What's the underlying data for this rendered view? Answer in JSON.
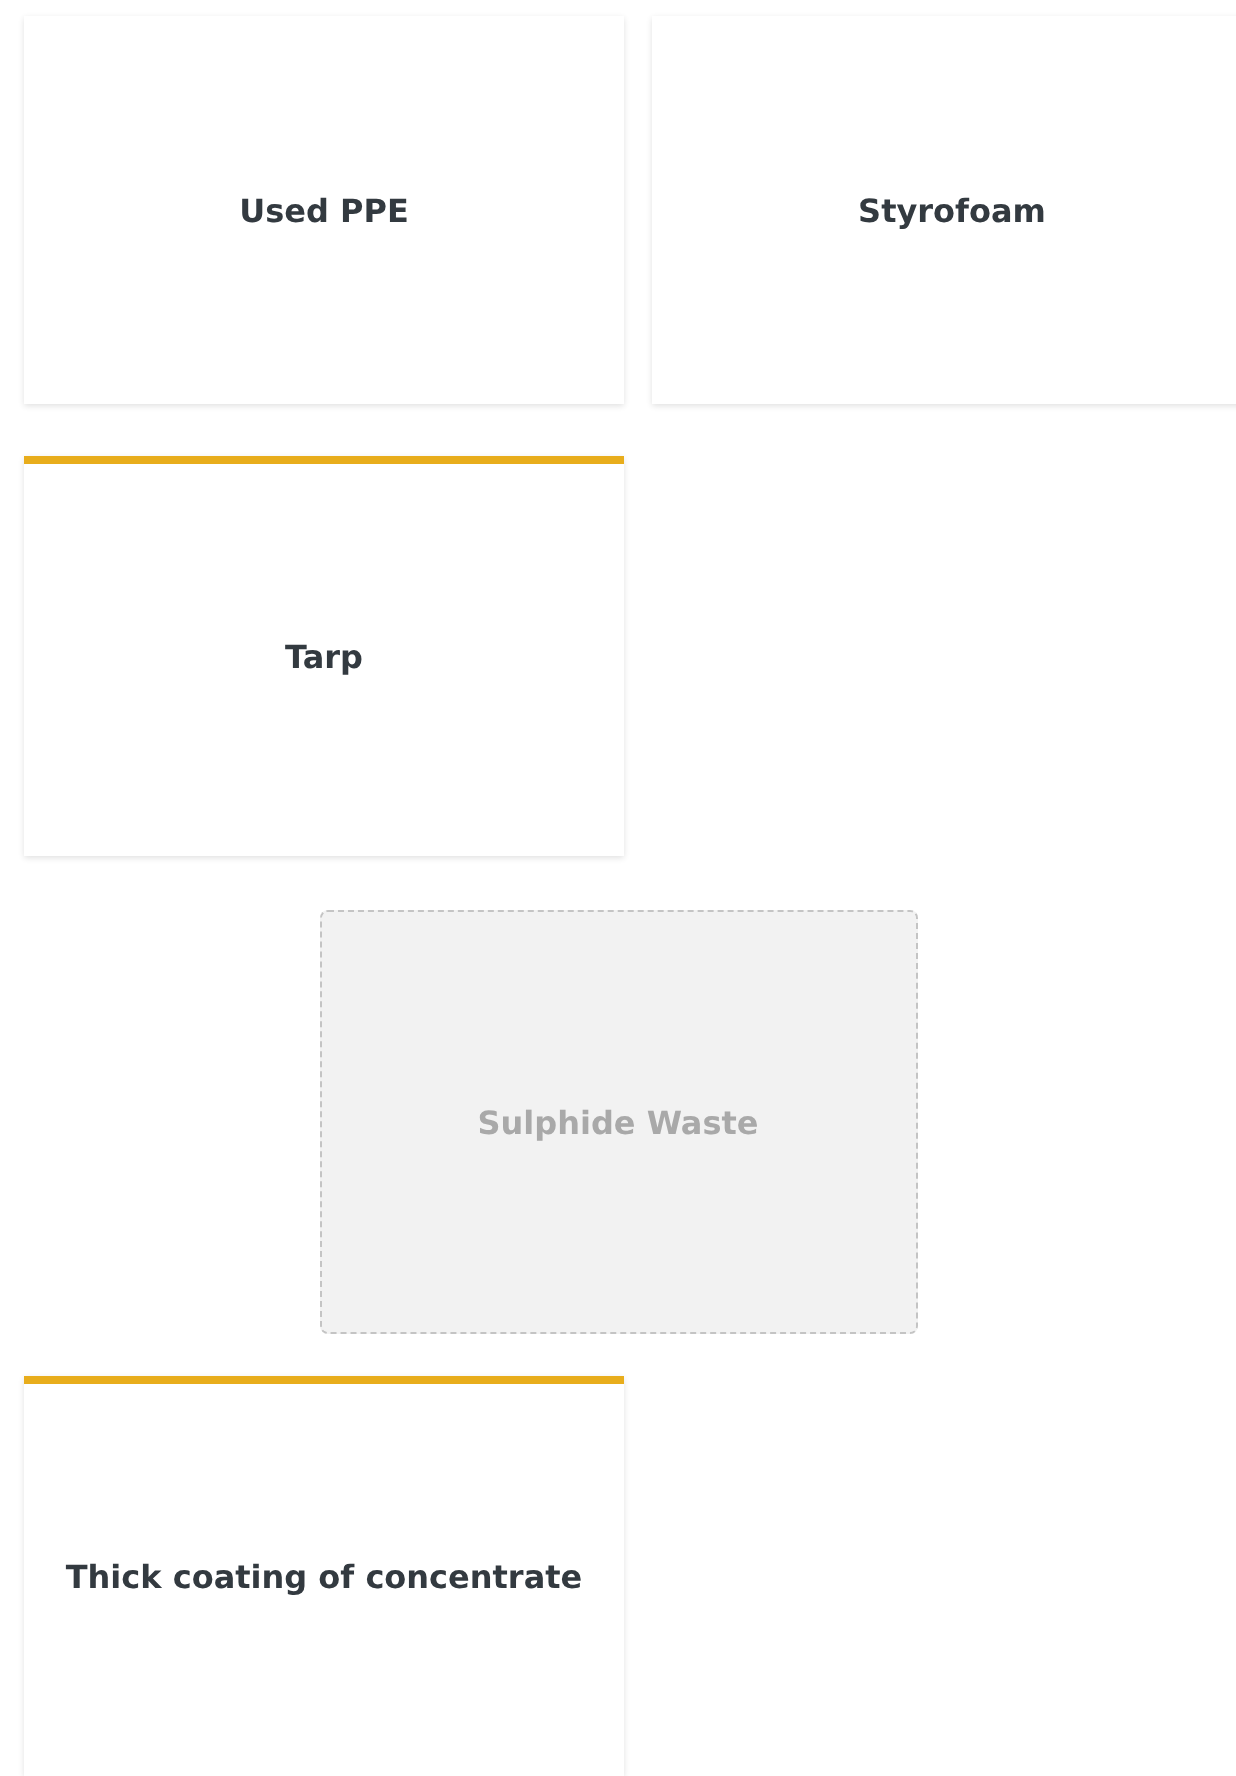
{
  "rows": [
    {
      "items": [
        {
          "kind": "card",
          "label": "Used PPE",
          "highlighted": false
        },
        {
          "kind": "card",
          "label": "Styrofoam",
          "highlighted": false
        }
      ]
    },
    {
      "items": [
        {
          "kind": "card",
          "label": "Tarp",
          "highlighted": true
        }
      ]
    },
    {
      "items": [
        {
          "kind": "placeholder",
          "label": "Sulphide Waste"
        }
      ]
    },
    {
      "items": [
        {
          "kind": "card",
          "label": "Thick coating of concentrate",
          "highlighted": true
        }
      ]
    }
  ]
}
